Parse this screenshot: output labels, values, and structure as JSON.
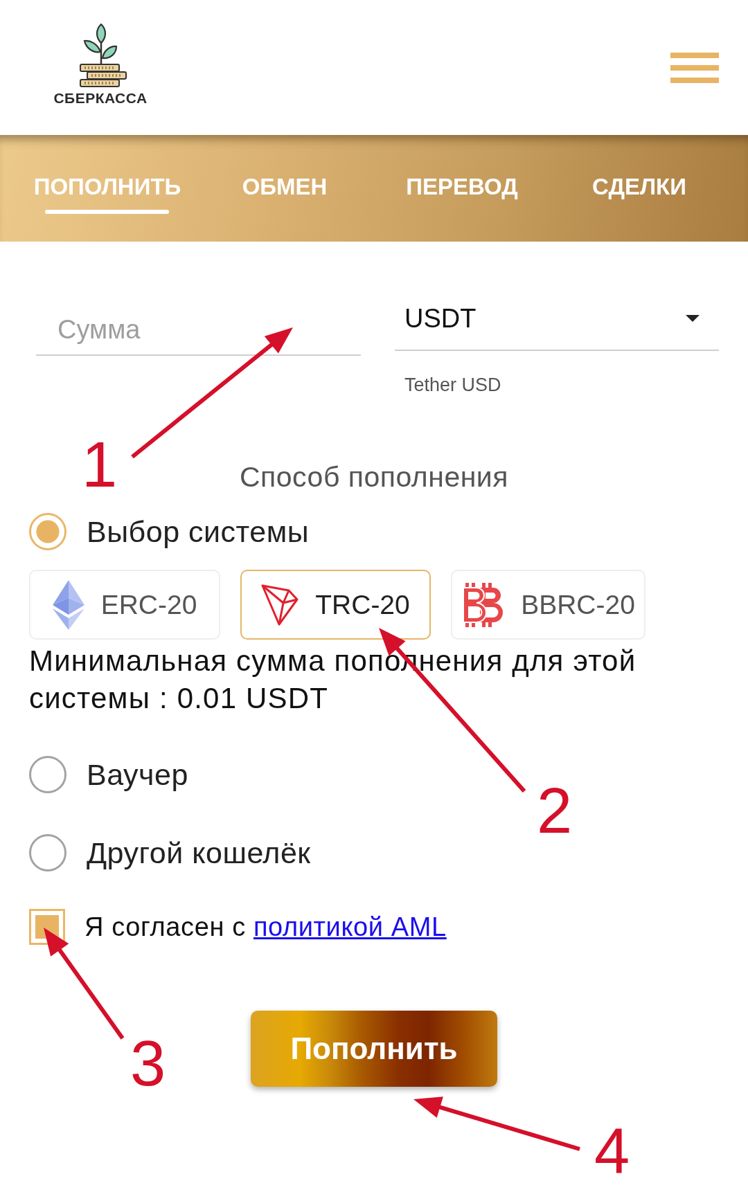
{
  "header": {
    "logo_text": "СБЕРКАССА"
  },
  "tabs": [
    {
      "label": "ПОПОЛНИТЬ",
      "selected": true
    },
    {
      "label": "ОБМЕН",
      "selected": false
    },
    {
      "label": "ПЕРЕВОД",
      "selected": false
    },
    {
      "label": "СДЕЛКИ",
      "selected": false
    }
  ],
  "amount_field": {
    "placeholder": "Сумма"
  },
  "currency_select": {
    "value": "USDT",
    "helper": "Tether USD"
  },
  "method": {
    "title": "Способ пополнения",
    "options": [
      {
        "label": "Выбор системы",
        "selected": true,
        "systems": [
          {
            "label": "ERC-20",
            "kind": "ethereum",
            "selected": false
          },
          {
            "label": "TRC-20",
            "kind": "tron",
            "selected": true
          },
          {
            "label": "BBRC-20",
            "kind": "bitcoin",
            "selected": false
          }
        ],
        "note": "Минимальная сумма пополнения для этой системы : 0.01 USDT"
      },
      {
        "label": "Ваучер",
        "selected": false
      },
      {
        "label": "Другой кошелёк",
        "selected": false
      }
    ]
  },
  "agreement": {
    "text": "Я согласен с",
    "link": "политикой AML",
    "checked": true
  },
  "submit": {
    "label": "Пополнить"
  },
  "annotations": [
    {
      "label": "1"
    },
    {
      "label": "2"
    },
    {
      "label": "3"
    },
    {
      "label": "4"
    }
  ]
}
